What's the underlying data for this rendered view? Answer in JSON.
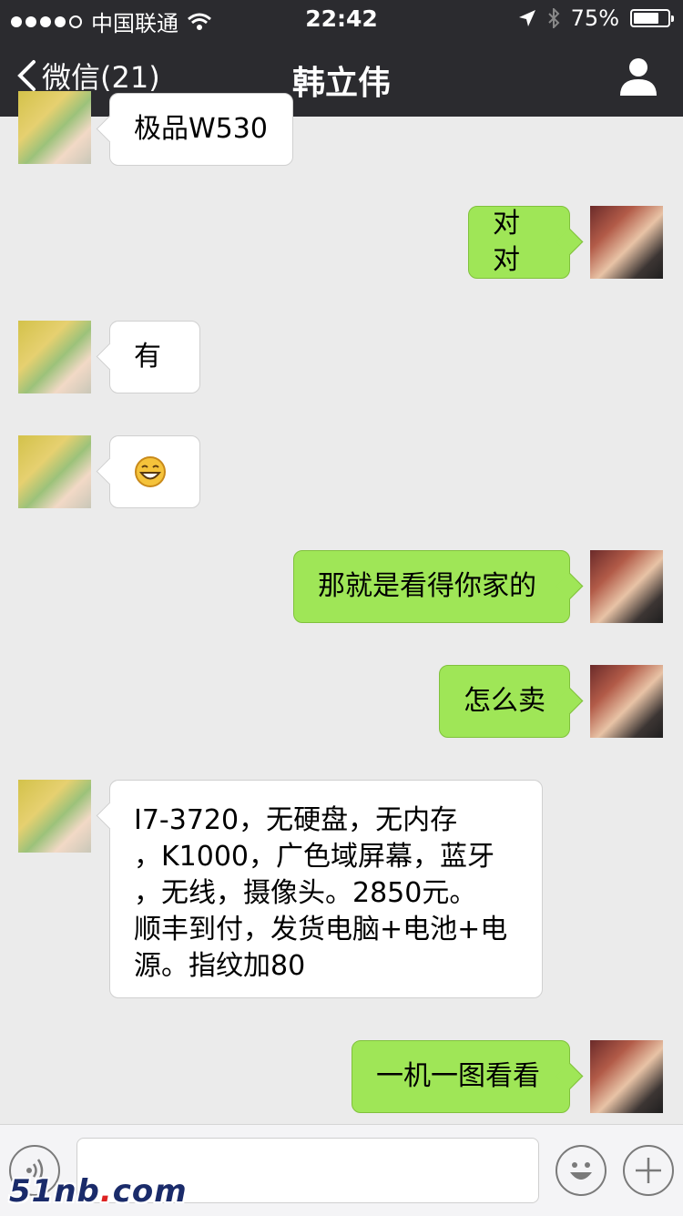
{
  "status_bar": {
    "carrier": "中国联通",
    "time": "22:42",
    "battery_percent": "75%",
    "battery_level": 0.75
  },
  "nav": {
    "back_label": "微信(21)",
    "title": "韩立伟"
  },
  "messages": [
    {
      "side": "left",
      "text": "极品W530"
    },
    {
      "side": "right",
      "text": "对对"
    },
    {
      "side": "left",
      "text": "有"
    },
    {
      "side": "left",
      "text": "",
      "emoji": "grinning-face-emoji"
    },
    {
      "side": "right",
      "text": "那就是看得你家的"
    },
    {
      "side": "right",
      "text": "怎么卖"
    },
    {
      "side": "left",
      "text": "I7-3720，无硬盘，无内存\n，K1000，广色域屏幕，蓝牙\n，无线，摄像头。2850元。\n顺丰到付，发货电脑+电池+电\n源。指纹加80"
    },
    {
      "side": "right",
      "text": "一机一图看看"
    }
  ],
  "watermark": {
    "brand": "51nb",
    "dot": ".",
    "tld": "com"
  },
  "colors": {
    "topbar": "#2b2b2f",
    "bubble_right": "#9fe657",
    "bubble_left": "#ffffff",
    "background": "#ebebeb"
  }
}
